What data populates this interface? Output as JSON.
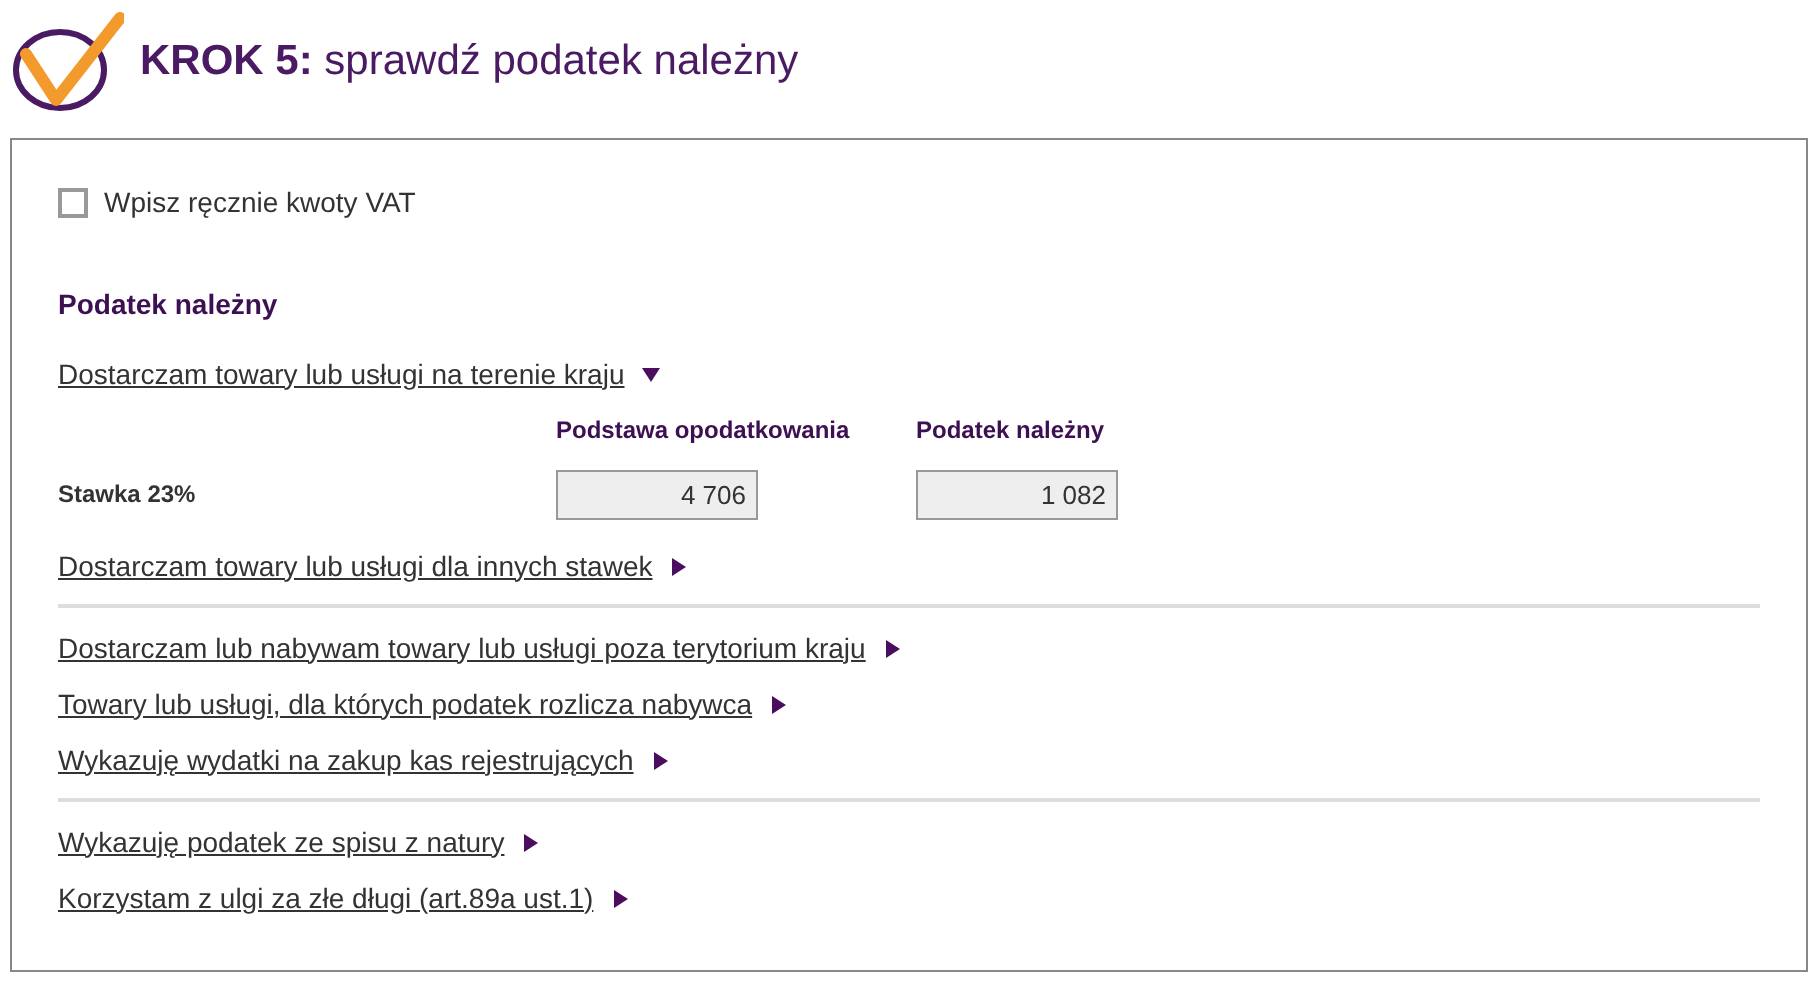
{
  "header": {
    "step": "KROK 5:",
    "title": "sprawdź podatek należny"
  },
  "manual_vat": {
    "label": "Wpisz ręcznie kwoty VAT",
    "checked": false
  },
  "section_title": "Podatek należny",
  "groups": [
    {
      "links": [
        {
          "label": "Dostarczam towary lub usługi na terenie kraju",
          "expanded": true,
          "table": {
            "columns": [
              "Podstawa opodatkowania",
              "Podatek należny"
            ],
            "rows": [
              {
                "label": "Stawka 23%",
                "values": [
                  "4 706",
                  "1 082"
                ]
              }
            ]
          }
        },
        {
          "label": "Dostarczam towary lub usługi dla innych stawek",
          "expanded": false
        }
      ]
    },
    {
      "links": [
        {
          "label": "Dostarczam lub nabywam towary lub usługi poza terytorium kraju",
          "expanded": false
        },
        {
          "label": "Towary lub usługi, dla których podatek rozlicza nabywca",
          "expanded": false
        },
        {
          "label": "Wykazuję wydatki na zakup kas rejestrujących",
          "expanded": false
        }
      ]
    },
    {
      "links": [
        {
          "label": "Wykazuję podatek ze spisu z natury",
          "expanded": false
        },
        {
          "label": "Korzystam z ulgi za złe długi (art.89a ust.1)",
          "expanded": false
        }
      ]
    }
  ]
}
